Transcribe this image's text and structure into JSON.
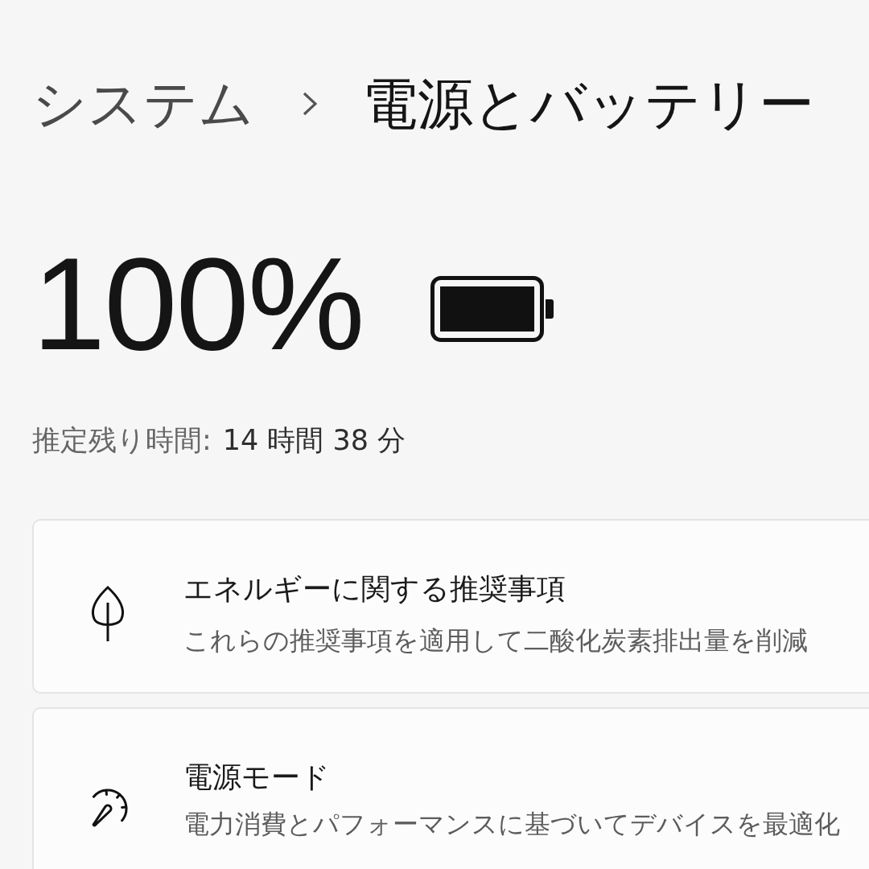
{
  "breadcrumb": {
    "parent": "システム",
    "current": "電源とバッテリー"
  },
  "battery": {
    "percent": "100%",
    "level": 1,
    "estimate_label": "推定残り時間:",
    "estimate_value": "14 時間 38 分"
  },
  "cards": [
    {
      "kind": "leaf",
      "title": "エネルギーに関する推奨事項",
      "description": "これらの推奨事項を適用して二酸化炭素排出量を削減"
    },
    {
      "kind": "gauge",
      "title": "電源モード",
      "description": "電力消費とパフォーマンスに基づいてデバイスを最適化"
    }
  ]
}
